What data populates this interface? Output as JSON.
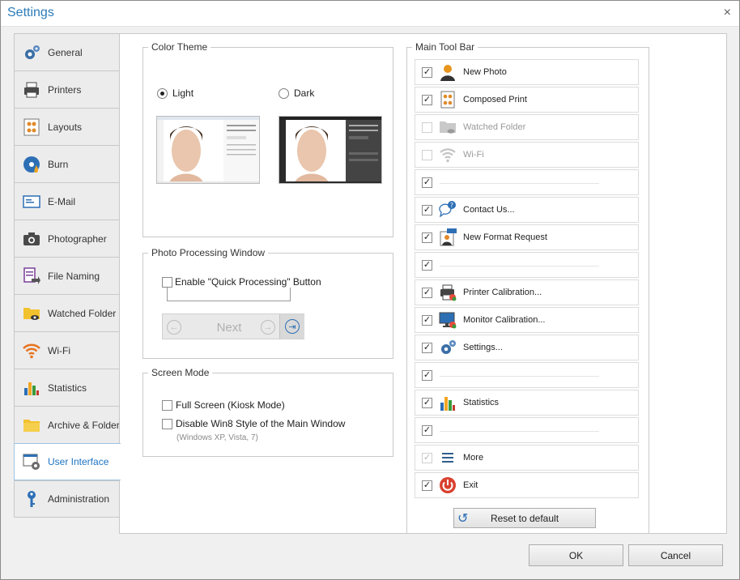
{
  "window": {
    "title": "Settings",
    "close_glyph": "×"
  },
  "tabs": [
    {
      "label": "General",
      "icon": "gear-icon"
    },
    {
      "label": "Printers",
      "icon": "printer-icon"
    },
    {
      "label": "Layouts",
      "icon": "layouts-icon"
    },
    {
      "label": "Burn",
      "icon": "burn-disc-icon"
    },
    {
      "label": "E-Mail",
      "icon": "email-icon"
    },
    {
      "label": "Photographer",
      "icon": "camera-icon"
    },
    {
      "label": "File Naming",
      "icon": "file-naming-icon"
    },
    {
      "label": "Watched Folder",
      "icon": "watched-folder-icon"
    },
    {
      "label": "Wi-Fi",
      "icon": "wifi-icon"
    },
    {
      "label": "Statistics",
      "icon": "statistics-icon"
    },
    {
      "label": "Archive & Folders",
      "icon": "folder-icon"
    },
    {
      "label": "User Interface",
      "icon": "user-interface-icon",
      "active": true
    },
    {
      "label": "Administration",
      "icon": "key-icon"
    }
  ],
  "color_theme": {
    "title": "Color Theme",
    "light_label": "Light",
    "dark_label": "Dark",
    "selected": "Light"
  },
  "photo_processing": {
    "title": "Photo Processing Window",
    "quick_processing_label": "Enable \"Quick Processing\" Button",
    "quick_processing_checked": false,
    "next_label": "Next"
  },
  "screen_mode": {
    "title": "Screen Mode",
    "fullscreen_label": "Full Screen (Kiosk Mode)",
    "fullscreen_checked": false,
    "disable_win8_label": "Disable Win8 Style of the Main Window",
    "disable_win8_checked": false,
    "disable_win8_hint": "(Windows XP, Vista, 7)"
  },
  "main_toolbar": {
    "title": "Main Tool Bar",
    "items": [
      {
        "label": "New Photo",
        "checked": true,
        "enabled": true,
        "icon": "new-photo-icon"
      },
      {
        "label": "Composed Print",
        "checked": true,
        "enabled": true,
        "icon": "composed-print-icon"
      },
      {
        "label": "Watched Folder",
        "checked": false,
        "enabled": false,
        "icon": "watched-folder-icon"
      },
      {
        "label": "Wi-Fi",
        "checked": false,
        "enabled": false,
        "icon": "wifi-icon"
      },
      {
        "label": "",
        "checked": true,
        "enabled": true,
        "separator": true
      },
      {
        "label": "Contact Us...",
        "checked": true,
        "enabled": true,
        "icon": "contact-us-icon"
      },
      {
        "label": "New Format Request",
        "checked": true,
        "enabled": true,
        "icon": "new-format-request-icon"
      },
      {
        "label": "",
        "checked": true,
        "enabled": true,
        "separator": true
      },
      {
        "label": "Printer Calibration...",
        "checked": true,
        "enabled": true,
        "icon": "printer-calibration-icon"
      },
      {
        "label": "Monitor Calibration...",
        "checked": true,
        "enabled": true,
        "icon": "monitor-calibration-icon"
      },
      {
        "label": "Settings...",
        "checked": true,
        "enabled": true,
        "icon": "settings-gear-icon"
      },
      {
        "label": "",
        "checked": true,
        "enabled": true,
        "separator": true
      },
      {
        "label": "Statistics",
        "checked": true,
        "enabled": true,
        "icon": "statistics-icon"
      },
      {
        "label": "",
        "checked": true,
        "enabled": true,
        "separator": true
      },
      {
        "label": "More",
        "checked": true,
        "enabled": false,
        "icon": "more-menu-icon"
      },
      {
        "label": "Exit",
        "checked": true,
        "enabled": true,
        "icon": "exit-power-icon"
      }
    ],
    "reset_label": "Reset to default"
  },
  "footer": {
    "ok_label": "OK",
    "cancel_label": "Cancel"
  },
  "check_glyph": "✓",
  "colors": {
    "accent": "#1d73c2",
    "title": "#2b7bb9"
  }
}
